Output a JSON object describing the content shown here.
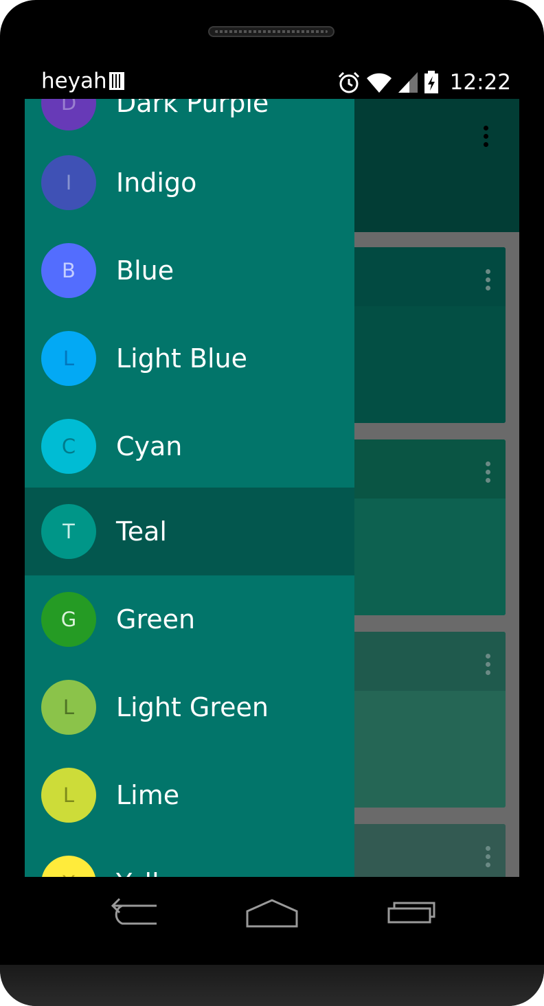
{
  "status_bar": {
    "carrier": "heyah",
    "time": "12:22",
    "icons": [
      "sim-icon",
      "alarm-icon",
      "wifi-icon",
      "signal-icon",
      "battery-charging-icon"
    ]
  },
  "app_toolbar": {
    "overflow_icon": "overflow-menu-icon",
    "color": "#023d35"
  },
  "cards": [
    {
      "head_color": "#024a41",
      "body_color": "#034f44"
    },
    {
      "head_color": "#0a5544",
      "body_color": "#0d6150"
    },
    {
      "head_color": "#1f5a4d",
      "body_color": "#256655"
    },
    {
      "head_color": "#335a52",
      "body_color": "#3a655b"
    }
  ],
  "drawer": {
    "background": "#02756a",
    "selected_background": "#03574e",
    "items": [
      {
        "initial": "D",
        "label": "Dark Purple",
        "color": "#673ab7",
        "initial_color": "#9a80d0"
      },
      {
        "initial": "I",
        "label": "Indigo",
        "color": "#3f51b5",
        "initial_color": "#8793d0"
      },
      {
        "initial": "B",
        "label": "Blue",
        "color": "#536dfe",
        "initial_color": "#c4ceff"
      },
      {
        "initial": "L",
        "label": "Light Blue",
        "color": "#03a9f4",
        "initial_color": "#0277bd"
      },
      {
        "initial": "C",
        "label": "Cyan",
        "color": "#00bcd4",
        "initial_color": "#017c8c"
      },
      {
        "initial": "T",
        "label": "Teal",
        "color": "#009688",
        "initial_color": "#c8efe9",
        "selected": true
      },
      {
        "initial": "G",
        "label": "Green",
        "color": "#259b24",
        "initial_color": "#d9f2d8"
      },
      {
        "initial": "L",
        "label": "Light Green",
        "color": "#8bc34a",
        "initial_color": "#4e7325"
      },
      {
        "initial": "L",
        "label": "Lime",
        "color": "#cddc39",
        "initial_color": "#7d8a1a"
      },
      {
        "initial": "Y",
        "label": "Yellow",
        "color": "#ffeb3b",
        "initial_color": "#b8a411"
      }
    ]
  },
  "nav_bar": {
    "icons": [
      "back-icon",
      "home-icon",
      "recent-apps-icon"
    ]
  }
}
